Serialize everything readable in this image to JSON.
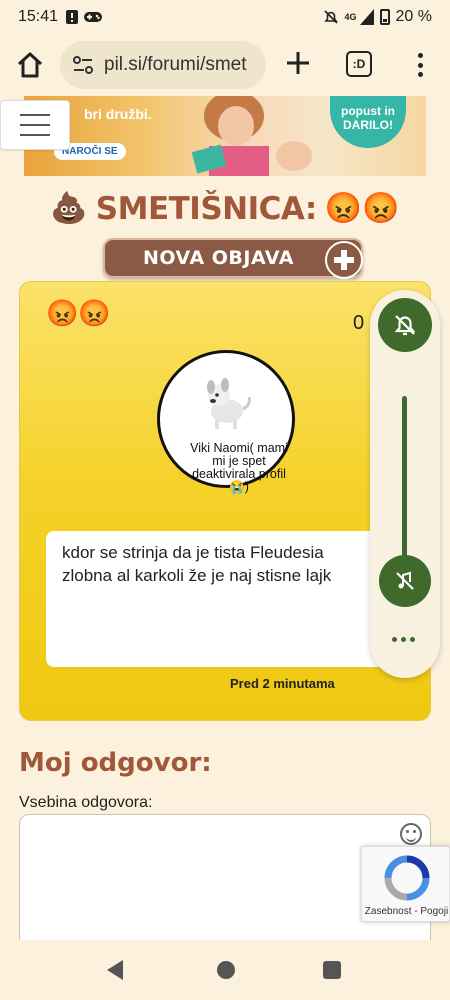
{
  "status_bar": {
    "time": "15:41",
    "network": "4G",
    "battery": "20 %"
  },
  "browser": {
    "url": "pil.si/forumi/smet",
    "tabs_label": ":D"
  },
  "banner": {
    "text": "bri družbi.",
    "cta": "NAROČI SE",
    "badge": "popust in DARILO!"
  },
  "page": {
    "title": "SMETIŠNICA:",
    "title_emoji_left": "💩",
    "title_emoji_right": "😡😡",
    "new_post_label": "NOVA OBJAVA"
  },
  "post": {
    "emojis": "😡😡",
    "count": "0",
    "author": "Viki Naomi( mami mi je spet deaktivirala profil😭)",
    "body": "kdor se strinja da je tista Fleudesia zlobna al karkoli že je naj stisne lajk",
    "time": "Pred 2 minutama"
  },
  "reply": {
    "title": "Moj odgovor:",
    "label": "Vsebina odgovora:"
  },
  "recaptcha": {
    "text": "Zasebnost - Pogoji"
  },
  "colors": {
    "accent_brown": "#a0573a",
    "post_yellow": "#f5d22b",
    "control_green": "#3f6a2b"
  }
}
